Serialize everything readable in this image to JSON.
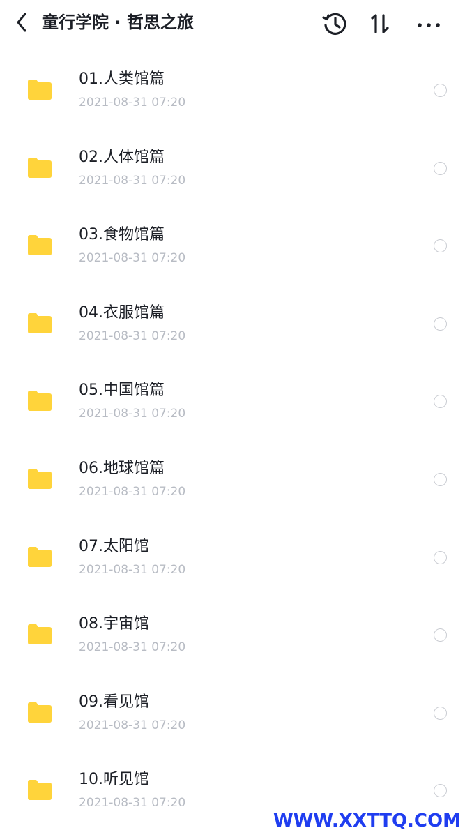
{
  "header": {
    "title": "童行学院 · 哲思之旅",
    "icons": {
      "back": "chevron-left-icon",
      "history": "history-icon",
      "sort": "sort-icon",
      "more": "more-icon"
    }
  },
  "list": {
    "items": [
      {
        "name": "01.人类馆篇",
        "date": "2021-08-31 07:20"
      },
      {
        "name": "02.人体馆篇",
        "date": "2021-08-31 07:20"
      },
      {
        "name": "03.食物馆篇",
        "date": "2021-08-31 07:20"
      },
      {
        "name": "04.衣服馆篇",
        "date": "2021-08-31 07:20"
      },
      {
        "name": "05.中国馆篇",
        "date": "2021-08-31 07:20"
      },
      {
        "name": "06.地球馆篇",
        "date": "2021-08-31 07:20"
      },
      {
        "name": "07.太阳馆",
        "date": "2021-08-31 07:20"
      },
      {
        "name": "08.宇宙馆",
        "date": "2021-08-31 07:20"
      },
      {
        "name": "09.看见馆",
        "date": "2021-08-31 07:20"
      },
      {
        "name": "10.听见馆",
        "date": "2021-08-31 07:20"
      }
    ]
  },
  "watermark": "WWW.XXTTQ.COM",
  "colors": {
    "folder": "#FFD43B",
    "text": "#1C1F26",
    "secondary": "#B8BCC4",
    "radio": "#C9CCD2",
    "watermark": "#1F3DF0"
  }
}
